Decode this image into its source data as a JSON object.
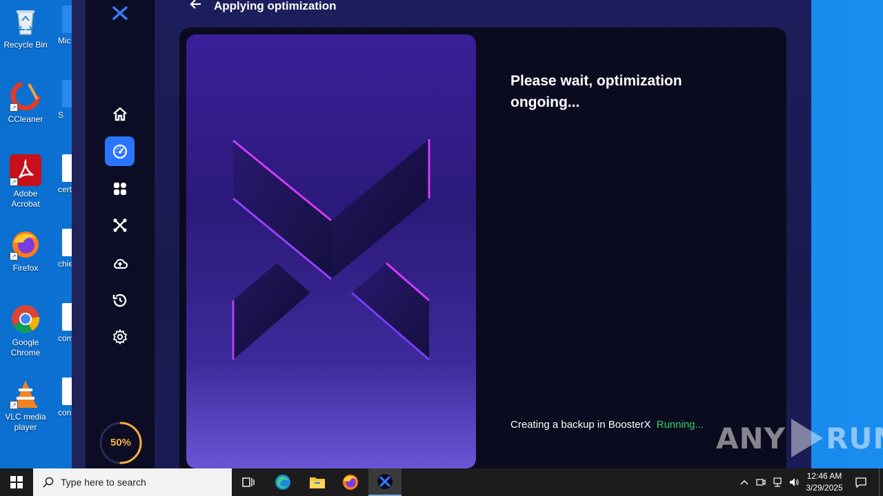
{
  "desktop": {
    "icons": [
      {
        "label": "Recycle Bin"
      },
      {
        "label": "CCleaner"
      },
      {
        "label": "Adobe Acrobat"
      },
      {
        "label": "Firefox"
      },
      {
        "label": "Google Chrome"
      },
      {
        "label": "VLC media player"
      }
    ],
    "partial_icons": [
      {
        "label": "Mic E"
      },
      {
        "label": "S"
      },
      {
        "label": "certi"
      },
      {
        "label": "chief"
      },
      {
        "label": "com"
      },
      {
        "label": "cons"
      }
    ]
  },
  "app": {
    "name": "BoosterX",
    "header": {
      "title": "Applying optimization"
    },
    "sidebar": {
      "items": [
        {
          "icon": "home-icon"
        },
        {
          "icon": "speedometer-icon",
          "active": true
        },
        {
          "icon": "apps-icon"
        },
        {
          "icon": "tools-icon"
        },
        {
          "icon": "cloud-upload-icon"
        },
        {
          "icon": "history-icon"
        },
        {
          "icon": "gear-icon"
        }
      ],
      "progress": {
        "label": "50%",
        "value": 0.5,
        "color": "#f3b33e"
      }
    },
    "content": {
      "wait_title": "Please wait, optimization ongoing...",
      "status_text": "Creating a backup in BoosterX",
      "status_state": "Running...",
      "status_state_color": "#2bd46a"
    }
  },
  "watermark": {
    "left": "ANY",
    "right": "RUN"
  },
  "taskbar": {
    "search_placeholder": "Type here to search",
    "apps": [
      {
        "icon": "task-view-icon"
      },
      {
        "icon": "edge-icon"
      },
      {
        "icon": "file-explorer-icon"
      },
      {
        "icon": "firefox-icon"
      },
      {
        "icon": "boosterx-icon",
        "active": true
      }
    ],
    "clock": {
      "time": "12:46 AM",
      "date": "3/29/2025"
    }
  },
  "colors": {
    "accent": "#2b74ff",
    "desktop": "#1a8cf0"
  }
}
